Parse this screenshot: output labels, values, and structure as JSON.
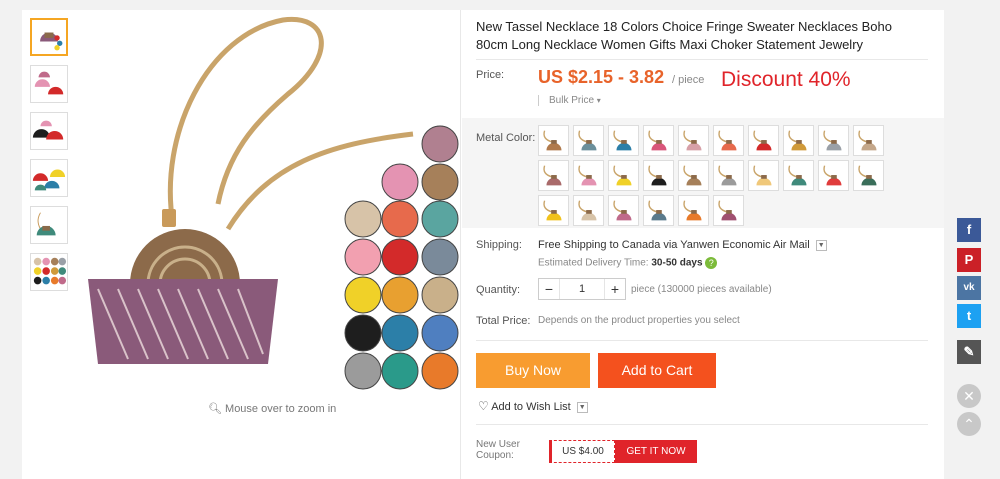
{
  "product": {
    "title": "New Tassel Necklace 18 Colors Choice Fringe Sweater Necklaces Boho 80cm Long Necklace Women Gifts Maxi Choker Statement Jewelry",
    "zoom_hint": "Mouse over to zoom in"
  },
  "price": {
    "label": "Price:",
    "range": "US $2.15 - 3.82",
    "unit": "/ piece",
    "discount": "Discount 40%",
    "bulk_label": "Bulk Price"
  },
  "metal_color": {
    "label": "Metal Color:",
    "swatches": [
      "#b07a4c",
      "#6b8f9b",
      "#2c7fa8",
      "#d9567a",
      "#d7a0a8",
      "#e76a4c",
      "#d32a2a",
      "#d09a3a",
      "#9aa0a7",
      "#c4a78a",
      "#a96a6a",
      "#e493b2",
      "#f0d128",
      "#1e1e1e",
      "#a6805a",
      "#9b9b9b",
      "#f0c87a",
      "#3f8a7b",
      "#e03c3c",
      "#3a6e5a",
      "#f1c21b",
      "#d7c3a8",
      "#c06a8a",
      "#5a7a8c",
      "#e87a2a",
      "#a05070"
    ]
  },
  "shipping": {
    "label": "Shipping:",
    "text": "Free Shipping to Canada via Yanwen Economic Air Mail",
    "delivery_prefix": "Estimated Delivery Time:",
    "delivery_days": "30-50 days"
  },
  "quantity": {
    "label": "Quantity:",
    "value": "1",
    "minus": "−",
    "plus": "+",
    "available": "piece (130000 pieces available)"
  },
  "total": {
    "label": "Total Price:",
    "text": "Depends on the product properties you select"
  },
  "actions": {
    "buy_now": "Buy Now",
    "add_to_cart": "Add to Cart",
    "wish_list": "Add to Wish List"
  },
  "coupon": {
    "label": "New User Coupon:",
    "value": "US $4.00",
    "button": "GET IT NOW"
  },
  "social": {
    "facebook": "f",
    "pinterest": "P",
    "vk": "vk",
    "twitter": "t"
  },
  "colors": {
    "price": "#e8632a",
    "discount": "#e0242a",
    "buy_now": "#f89c30",
    "add_to_cart": "#f4511e"
  }
}
